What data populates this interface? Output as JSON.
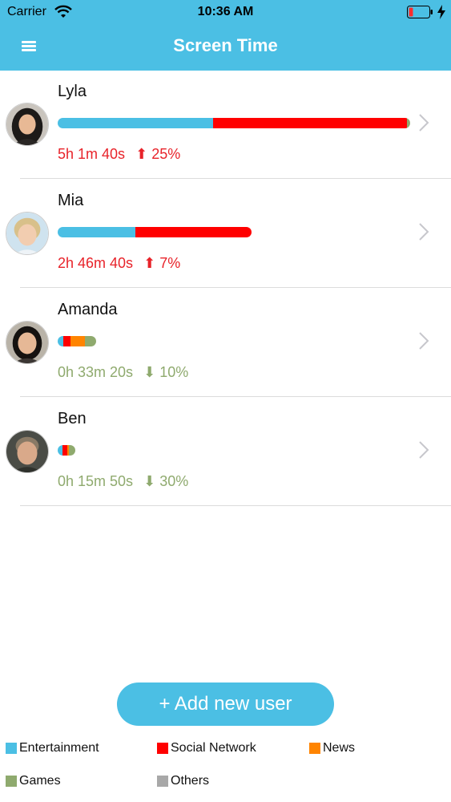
{
  "status_bar": {
    "carrier": "Carrier",
    "time": "10:36 AM"
  },
  "nav": {
    "title": "Screen Time"
  },
  "colors": {
    "entertainment": "#4bbfe4",
    "social": "#ff0000",
    "news": "#ff8400",
    "games": "#8faa6e",
    "others": "#a8a8a8",
    "increase": "#e8232a",
    "decrease": "#8faa6e"
  },
  "users": [
    {
      "name": "Lyla",
      "time": "5h 1m 40s",
      "change": "25%",
      "trend": "up",
      "usage_share_of_max": 1.0,
      "breakdown": [
        {
          "category": "entertainment",
          "share": 0.44
        },
        {
          "category": "social",
          "share": 0.55
        },
        {
          "category": "games",
          "share": 0.01
        }
      ]
    },
    {
      "name": "Mia",
      "time": "2h 46m 40s",
      "change": "7%",
      "trend": "up",
      "usage_share_of_max": 0.55,
      "breakdown": [
        {
          "category": "entertainment",
          "share": 0.4
        },
        {
          "category": "social",
          "share": 0.6
        }
      ]
    },
    {
      "name": "Amanda",
      "time": "0h 33m 20s",
      "change": "10%",
      "trend": "down",
      "usage_share_of_max": 0.11,
      "breakdown": [
        {
          "category": "entertainment",
          "share": 0.15
        },
        {
          "category": "social",
          "share": 0.18
        },
        {
          "category": "news",
          "share": 0.37
        },
        {
          "category": "games",
          "share": 0.3
        }
      ]
    },
    {
      "name": "Ben",
      "time": "0h 15m 50s",
      "change": "30%",
      "trend": "down",
      "usage_share_of_max": 0.05,
      "breakdown": [
        {
          "category": "entertainment",
          "share": 0.25
        },
        {
          "category": "social",
          "share": 0.3
        },
        {
          "category": "news",
          "share": 0.1
        },
        {
          "category": "games",
          "share": 0.35
        }
      ]
    }
  ],
  "add_button": {
    "label": "+ Add new user"
  },
  "legend": [
    {
      "key": "entertainment",
      "label": "Entertainment"
    },
    {
      "key": "social",
      "label": "Social Network"
    },
    {
      "key": "news",
      "label": "News"
    },
    {
      "key": "games",
      "label": "Games"
    },
    {
      "key": "others",
      "label": "Others"
    }
  ]
}
